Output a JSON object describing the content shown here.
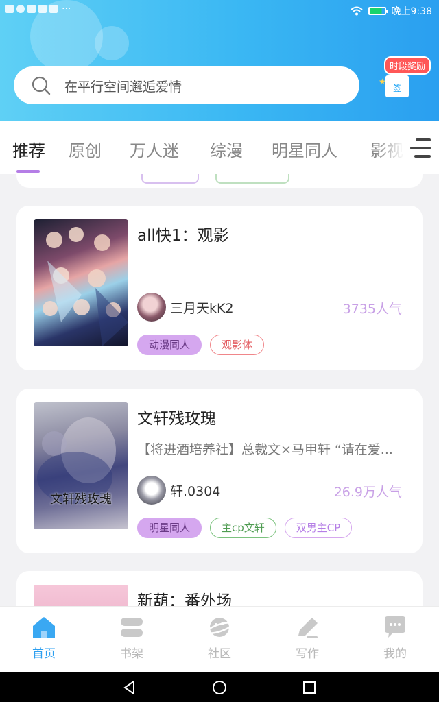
{
  "status_bar": {
    "time": "晚上9:38",
    "overflow": "···"
  },
  "search": {
    "placeholder": "在平行空间邂逅爱情"
  },
  "reward": {
    "label": "时段奖励",
    "gift_label": "签"
  },
  "tabs": [
    {
      "label": "推荐",
      "active": true
    },
    {
      "label": "原创"
    },
    {
      "label": "万人迷"
    },
    {
      "label": "综漫"
    },
    {
      "label": "明星同人"
    },
    {
      "label": "影视"
    }
  ],
  "cards": [
    {
      "title": "all快1：观影",
      "summary": "",
      "author": "三月天kK2",
      "popularity": "3735人气",
      "tags": [
        "动漫同人",
        "观影体"
      ]
    },
    {
      "title": "文轩残玫瑰",
      "summary": "【将进酒培养社】总裁文×马甲轩 “请在爱...",
      "author": "轩.0304",
      "popularity": "26.9万人气",
      "cover_text": "文轩残玫瑰",
      "tags": [
        "明星同人",
        "主cp文轩",
        "双男主CP"
      ]
    },
    {
      "title": "新葫：番外场"
    }
  ],
  "bottom_nav": [
    {
      "label": "首页",
      "icon": "home-icon",
      "active": true
    },
    {
      "label": "书架",
      "icon": "bookshelf-icon"
    },
    {
      "label": "社区",
      "icon": "community-planet-icon"
    },
    {
      "label": "写作",
      "icon": "write-pen-icon"
    },
    {
      "label": "我的",
      "icon": "profile-chat-icon"
    }
  ],
  "colors": {
    "accent_blue": "#2c9ff0",
    "accent_purple": "#b57ee6",
    "tag_red": "#e35c61",
    "tag_green": "#4f9c52"
  }
}
